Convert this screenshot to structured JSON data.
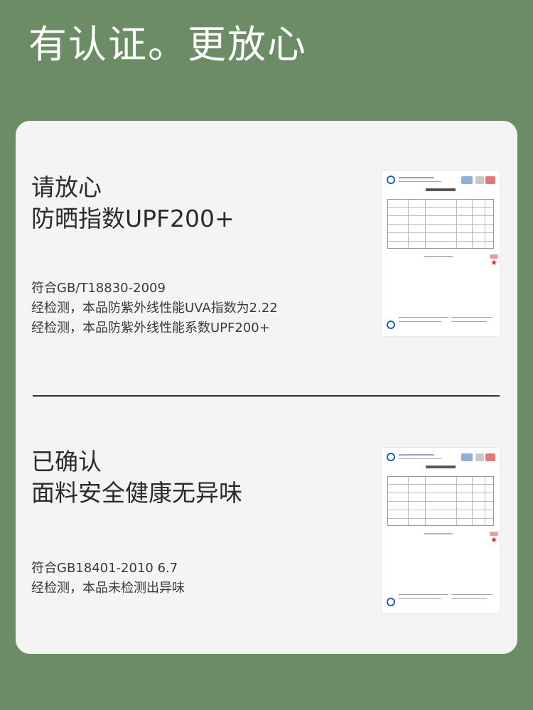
{
  "page": {
    "title": "有认证。更放心"
  },
  "sections": [
    {
      "headline": [
        "请放心",
        "防晒指数UPF200+"
      ],
      "details": [
        "符合GB/T18830-2009",
        "经检测，本品防紫外线性能UVA指数为2.22",
        "经检测，本品防紫外线性能系数UPF200+"
      ]
    },
    {
      "headline": [
        "已确认",
        "面料安全健康无异味"
      ],
      "details": [
        "符合GB18401-2010 6.7",
        "经检测，本品未检测出异味"
      ]
    }
  ],
  "colors": {
    "background": "#6b8c64",
    "card": "#f4f4f4",
    "text_dark": "#2b2b2b",
    "logo_blue": "#2a5f9e",
    "stamp_red": "#d23"
  }
}
